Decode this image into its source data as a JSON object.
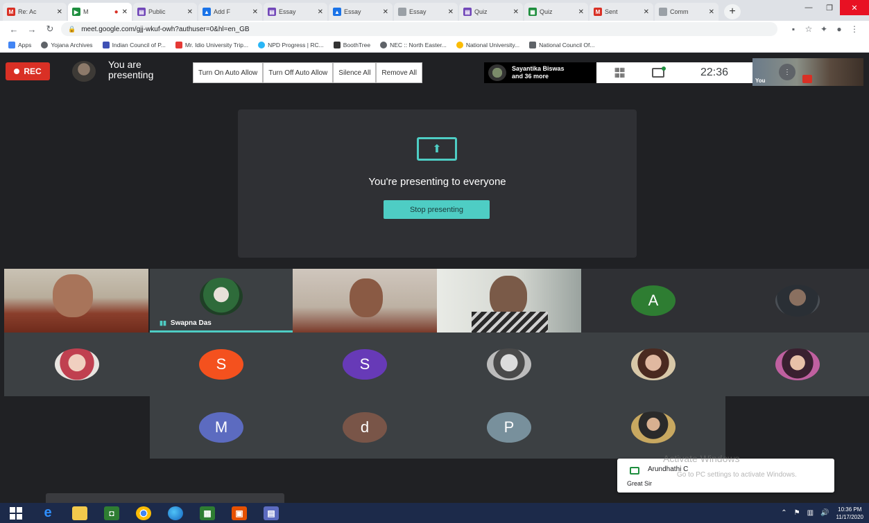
{
  "browser": {
    "tabs": [
      {
        "label": "Re: Ac",
        "icon": "gmail-icon",
        "color": "#d93025",
        "fav": "M"
      },
      {
        "label": "M",
        "icon": "meet-icon",
        "color": "#1e8e3e",
        "fav": "",
        "active": true
      },
      {
        "label": "Public",
        "icon": "forms-icon",
        "color": "#7248b9",
        "fav": "▤"
      },
      {
        "label": "Add F",
        "icon": "drive-icon",
        "color": "#1a73e8",
        "fav": "▲"
      },
      {
        "label": "Essay",
        "icon": "forms-icon",
        "color": "#7248b9",
        "fav": "▤"
      },
      {
        "label": "Essay",
        "icon": "drive-icon",
        "color": "#1a73e8",
        "fav": "▲"
      },
      {
        "label": "Essay",
        "icon": "doc-icon",
        "color": "#9aa0a6",
        "fav": ""
      },
      {
        "label": "Quiz",
        "icon": "forms-icon",
        "color": "#7248b9",
        "fav": "▤"
      },
      {
        "label": "Quiz",
        "icon": "sheets-icon",
        "color": "#1e8e3e",
        "fav": "▦"
      },
      {
        "label": "Sent",
        "icon": "gmail-icon",
        "color": "#d93025",
        "fav": "M"
      },
      {
        "label": "Comm",
        "icon": "doc-icon",
        "color": "#9aa0a6",
        "fav": ""
      }
    ],
    "url": "meet.google.com/gjj-wkuf-owh?authuser=0&hl=en_GB",
    "bookmarks": [
      {
        "label": "Apps",
        "color": "#4285f4"
      },
      {
        "label": "Yojana Archives",
        "color": "#5f6368"
      },
      {
        "label": "Indian Council of P...",
        "color": "#3f51b5"
      },
      {
        "label": "Mr. Idio University Trip...",
        "color": "#e53935"
      },
      {
        "label": "NPD Progress | RC...",
        "color": "#29b6f6"
      },
      {
        "label": "BoothTree",
        "color": "#333333"
      },
      {
        "label": "NEC :: North Easter...",
        "color": "#5f6368"
      },
      {
        "label": "National University...",
        "color": "#fbbc05"
      },
      {
        "label": "National Council Of...",
        "color": "#5f6368"
      }
    ]
  },
  "meet": {
    "rec_label": "REC",
    "presenting_status": "You are presenting",
    "controls": [
      "Turn On Auto Allow",
      "Turn Off Auto Allow",
      "Silence All",
      "Remove All"
    ],
    "participants_line1": "Sayantika Biswas",
    "participants_line2": "and 36 more",
    "clock": "22:36",
    "self_label": "You",
    "present_message": "You're presenting to everyone",
    "stop_button": "Stop presenting",
    "speaker_name": "Swapna Das",
    "initials": [
      {
        "letter": "A",
        "color": "#2e7d32"
      },
      {
        "letter": "S",
        "color": "#f4511e"
      },
      {
        "letter": "S",
        "color": "#673ab7"
      },
      {
        "letter": "M",
        "color": "#5c6bc0"
      },
      {
        "letter": "d",
        "color": "#795548"
      },
      {
        "letter": "P",
        "color": "#78909c"
      }
    ]
  },
  "toast": {
    "sender": "Arundhathi C",
    "message": "Great Sir",
    "watermark_title": "Activate Windows",
    "watermark_sub": "Go to PC settings to activate Windows."
  },
  "taskbar": {
    "apps": [
      "start-icon",
      "edge-icon",
      "file-explorer-icon",
      "store-icon",
      "chrome-icon",
      "edge-new-icon",
      "sheets-icon",
      "slides-icon",
      "files-icon"
    ],
    "time": "10:36 PM",
    "date": "11/17/2020"
  }
}
